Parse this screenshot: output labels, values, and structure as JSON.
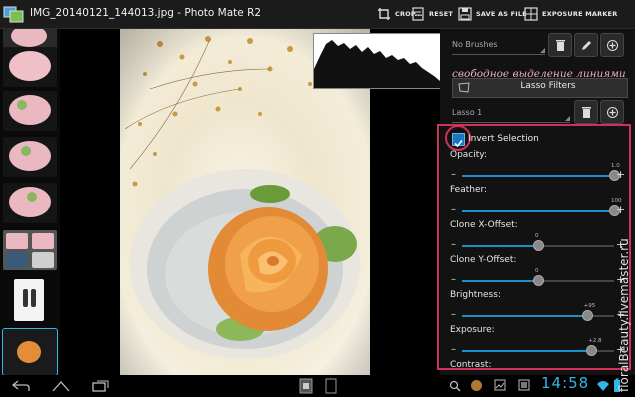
{
  "app": {
    "title": "IMG_20140121_144013.jpg - Photo Mate R2"
  },
  "toolbar": {
    "crop_label": "CROP...",
    "reset_label": "RESET",
    "save_as_file_label": "SAVE AS FILE",
    "exposure_marker_label": "EXPOSURE MARKER"
  },
  "panel": {
    "brushes_dropdown": "No Brushes",
    "overlay_caption": "свободное выделение линиями",
    "filters_label": "Lasso Filters",
    "lasso_dropdown": "Lasso 1",
    "invert_selection": {
      "label": "Invert Selection",
      "checked": true
    },
    "sliders": [
      {
        "label": "Opacity:",
        "value": "1.0",
        "fraction": 1.0
      },
      {
        "label": "Feather:",
        "value": "100",
        "fraction": 1.0
      },
      {
        "label": "Clone X-Offset:",
        "value": "0",
        "fraction": 0.5
      },
      {
        "label": "Clone Y-Offset:",
        "value": "0",
        "fraction": 0.5
      },
      {
        "label": "Brightness:",
        "value": "+95",
        "fraction": 0.82
      },
      {
        "label": "Exposure:",
        "value": "+2.8",
        "fraction": 0.85
      },
      {
        "label": "Contrast:",
        "value": "",
        "fraction": 0.5
      }
    ]
  },
  "statusbar": {
    "clock": "14:58"
  },
  "watermark": "floralBeauty.livemaster.ru",
  "colors": {
    "accent": "#33b5e5",
    "highlight": "#d0305a",
    "slider": "#1a8fd0"
  }
}
